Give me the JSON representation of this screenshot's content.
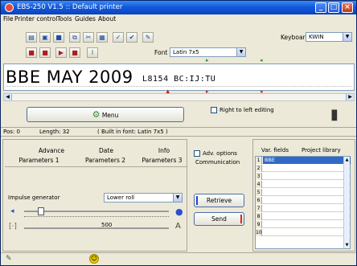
{
  "app": {
    "title": "EBS-250 V1.5 :: Default printer"
  },
  "menu": [
    "File",
    "Printer control",
    "Tools",
    "Guides",
    "About"
  ],
  "toolbar": {
    "keyboard_label": "Keyboard",
    "keyboard_value": "KWIN",
    "font_label": "Font",
    "font_value": "Latin 7x5"
  },
  "editor": {
    "large_line": "BBE MAY 2009",
    "small_line": "L8154 BC:IJ:TU"
  },
  "controls": {
    "menu_button": "Menu",
    "rtl_checkbox": "Right to left editing"
  },
  "status_line": {
    "pos": "Pos: 0",
    "length": "Length: 32",
    "font_info": "( Built in font: Latin 7x5 )"
  },
  "tabs": {
    "row1": [
      "Advance",
      "Date",
      "Info"
    ],
    "row2": [
      "Parameters 1",
      "Parameters 2",
      "Parameters 3"
    ]
  },
  "params": {
    "impulse_label": "Impulse generator",
    "impulse_value": "Lower roll",
    "slider_value": "500",
    "slider_level": 0.1
  },
  "side": {
    "adv_options": "Adv. options",
    "communication": "Communication",
    "retrieve": "Retrieve",
    "send": "Send"
  },
  "var_table": {
    "headers": [
      "Var. fields",
      "Project library"
    ],
    "rows": [
      "1",
      "2",
      "3",
      "4",
      "5",
      "6",
      "7",
      "8",
      "9",
      "10"
    ],
    "first_value": "BBE"
  },
  "colors": {
    "accent_blue": "#1459d9",
    "retrieve_bar": "#2a3fd0",
    "send_bar": "#d02a2a",
    "selection": "#316ac5"
  }
}
